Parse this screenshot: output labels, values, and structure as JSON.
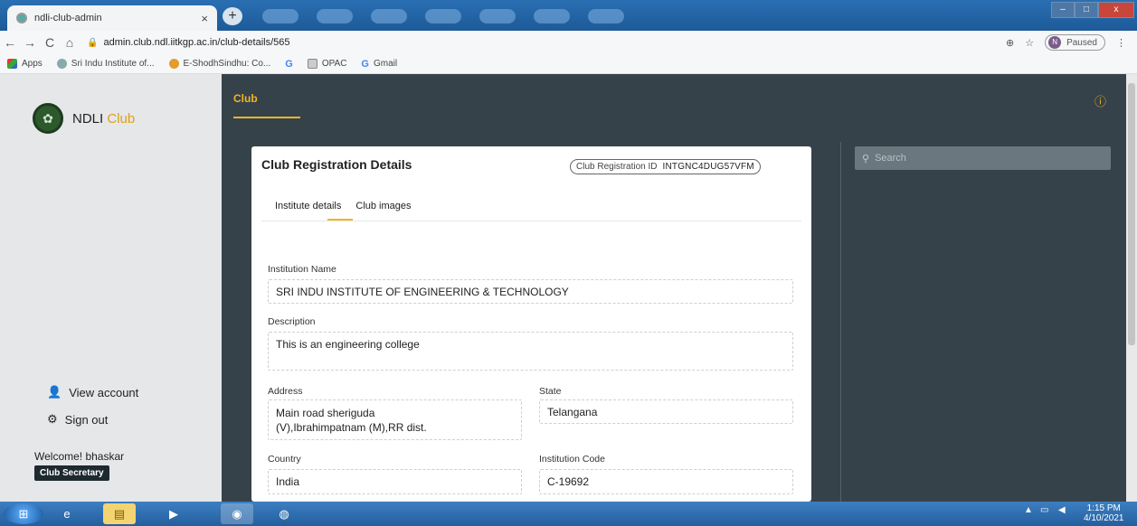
{
  "browser": {
    "tab_title": "ndli-club-admin",
    "tab_close": "×",
    "new_tab": "+",
    "nav_back": "←",
    "nav_forward": "→",
    "nav_reload": "C",
    "nav_home": "⌂",
    "url": "admin.club.ndl.iitkgp.ac.in/club-details/565",
    "profile_initial": "N",
    "profile_status": "Paused",
    "bookmarks": [
      "Apps",
      "Sri Indu Institute of...",
      "E-ShodhSindhu: Co...",
      "OPAC",
      "Gmail"
    ]
  },
  "sidebar": {
    "logo_text": "NDLI",
    "logo_accent": "Club",
    "view_account": "View account",
    "sign_out": "Sign out",
    "welcome": "Welcome! bhaskar",
    "role": "Club Secretary"
  },
  "header": {
    "tab": "Club",
    "info_icon": "ⓘ"
  },
  "card": {
    "title": "Club Registration Details",
    "reg_id_label": "Club Registration ID",
    "reg_id_value": "INTGNC4DUG57VFM",
    "tabs": [
      "Institute details",
      "Club images"
    ],
    "fields": {
      "institution_name_label": "Institution Name",
      "institution_name": "SRI INDU INSTITUTE OF ENGINEERING & TECHNOLOGY",
      "description_label": "Description",
      "description": "This is an engineering college",
      "address_label": "Address",
      "address_line1": "Main road sheriguda",
      "address_line2": "(V),Ibrahimpatnam (M),RR dist.",
      "state_label": "State",
      "state": "Telangana",
      "country_label": "Country",
      "country": "India",
      "institution_code_label": "Institution Code",
      "institution_code": "C-19692"
    }
  },
  "search": {
    "placeholder": "Search"
  },
  "taskbar": {
    "time": "1:15 PM",
    "date": "4/10/2021"
  },
  "colors": {
    "accent": "#f0b528",
    "app_bg": "#35424a",
    "sidebar_bg": "#e5e7e9"
  }
}
